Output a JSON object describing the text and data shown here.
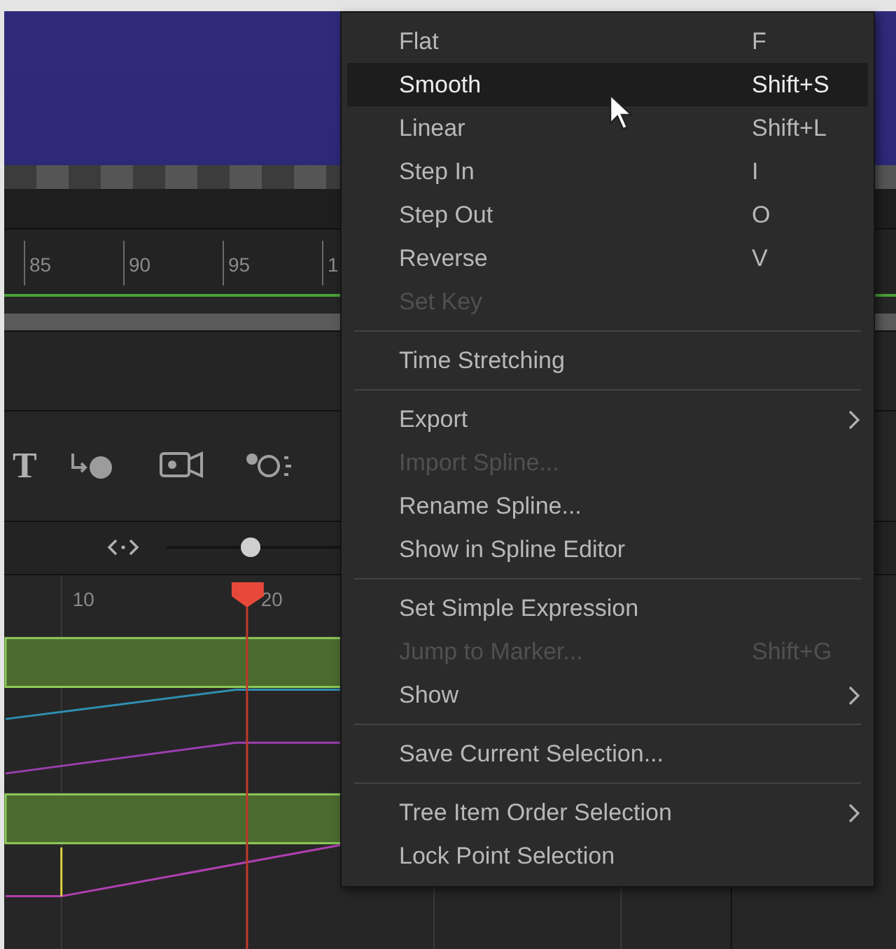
{
  "ruler": {
    "labels": [
      "85",
      "90",
      "95",
      "1"
    ]
  },
  "toolbar": {
    "text_tool_glyph": "T"
  },
  "zoom_slider": {
    "level": 0.48
  },
  "timeline": {
    "labels": [
      "10",
      "20"
    ]
  },
  "context_menu": {
    "items": [
      {
        "kind": "item",
        "label": "Flat",
        "shortcut": "F",
        "selected": false,
        "disabled": false,
        "submenu": false
      },
      {
        "kind": "item",
        "label": "Smooth",
        "shortcut": "Shift+S",
        "selected": true,
        "disabled": false,
        "submenu": false
      },
      {
        "kind": "item",
        "label": "Linear",
        "shortcut": "Shift+L",
        "selected": false,
        "disabled": false,
        "submenu": false
      },
      {
        "kind": "item",
        "label": "Step In",
        "shortcut": "I",
        "selected": false,
        "disabled": false,
        "submenu": false
      },
      {
        "kind": "item",
        "label": "Step Out",
        "shortcut": "O",
        "selected": false,
        "disabled": false,
        "submenu": false
      },
      {
        "kind": "item",
        "label": "Reverse",
        "shortcut": "V",
        "selected": false,
        "disabled": false,
        "submenu": false
      },
      {
        "kind": "item",
        "label": "Set Key",
        "selected": false,
        "disabled": true,
        "submenu": false
      },
      {
        "kind": "separator"
      },
      {
        "kind": "item",
        "label": "Time Stretching",
        "selected": false,
        "disabled": false,
        "submenu": false
      },
      {
        "kind": "separator"
      },
      {
        "kind": "item",
        "label": "Export",
        "selected": false,
        "disabled": false,
        "submenu": true
      },
      {
        "kind": "item",
        "label": "Import Spline...",
        "selected": false,
        "disabled": true,
        "submenu": false
      },
      {
        "kind": "item",
        "label": "Rename Spline...",
        "selected": false,
        "disabled": false,
        "submenu": false
      },
      {
        "kind": "item",
        "label": "Show in Spline Editor",
        "selected": false,
        "disabled": false,
        "submenu": false
      },
      {
        "kind": "separator"
      },
      {
        "kind": "item",
        "label": "Set Simple Expression",
        "selected": false,
        "disabled": false,
        "submenu": false
      },
      {
        "kind": "item",
        "label": "Jump to Marker...",
        "shortcut": "Shift+G",
        "selected": false,
        "disabled": true,
        "submenu": false
      },
      {
        "kind": "item",
        "label": "Show",
        "selected": false,
        "disabled": false,
        "submenu": true
      },
      {
        "kind": "separator"
      },
      {
        "kind": "item",
        "label": "Save Current Selection...",
        "selected": false,
        "disabled": false,
        "submenu": false
      },
      {
        "kind": "separator"
      },
      {
        "kind": "item",
        "label": "Tree Item Order Selection",
        "selected": false,
        "disabled": false,
        "submenu": true
      },
      {
        "kind": "item",
        "label": "Lock Point Selection",
        "selected": false,
        "disabled": false,
        "submenu": false
      }
    ]
  }
}
